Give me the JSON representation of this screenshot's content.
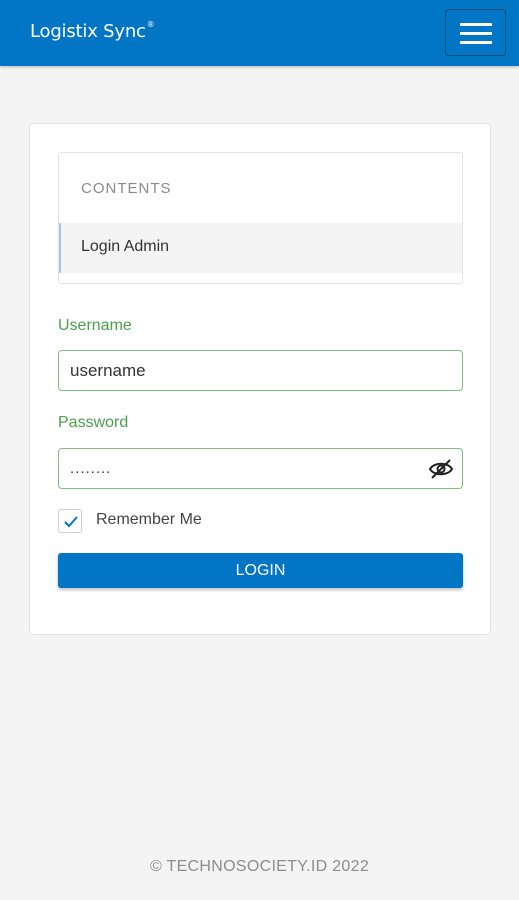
{
  "header": {
    "brand": "Logistix Sync",
    "brand_mark": "®",
    "menu_icon": "hamburger-menu-icon"
  },
  "contents": {
    "heading": "CONTENTS",
    "items": [
      {
        "label": "Login Admin",
        "active": true
      }
    ]
  },
  "form": {
    "username_label": "Username",
    "username_value": "username",
    "password_label": "Password",
    "password_value": "........",
    "password_toggle_icon": "eye-slash-icon",
    "remember_label": "Remember Me",
    "remember_checked": true,
    "login_label": "LOGIN"
  },
  "footer": {
    "copyright": "© TECHNOSOCIETY.ID 2022"
  },
  "colors": {
    "primary": "#0275c4",
    "field_label": "#4aa04a",
    "field_border": "#7cc07c",
    "background": "#f4f4f4"
  }
}
